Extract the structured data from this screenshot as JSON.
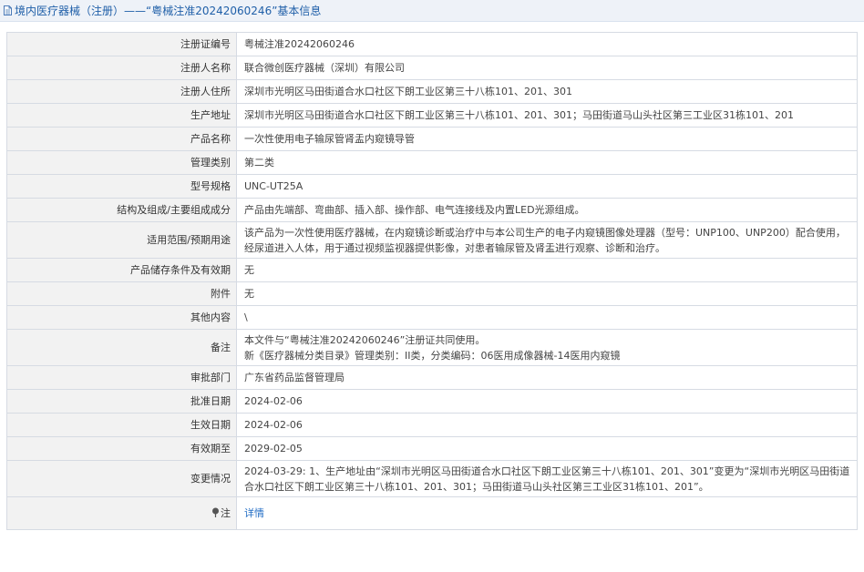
{
  "header": {
    "title": "境内医疗器械（注册）——“粤械注准20242060246”基本信息"
  },
  "rows": [
    {
      "label": "注册证编号",
      "value": "粤械注准20242060246"
    },
    {
      "label": "注册人名称",
      "value": "联合微创医疗器械（深圳）有限公司"
    },
    {
      "label": "注册人住所",
      "value": "深圳市光明区马田街道合水口社区下朗工业区第三十八栋101、201、301"
    },
    {
      "label": "生产地址",
      "value": "深圳市光明区马田街道合水口社区下朗工业区第三十八栋101、201、301；马田街道马山头社区第三工业区31栋101、201"
    },
    {
      "label": "产品名称",
      "value": "一次性使用电子输尿管肾盂内窥镜导管"
    },
    {
      "label": "管理类别",
      "value": "第二类"
    },
    {
      "label": "型号规格",
      "value": "UNC-UT25A"
    },
    {
      "label": "结构及组成/主要组成成分",
      "value": "产品由先端部、弯曲部、插入部、操作部、电气连接线及内置LED光源组成。"
    },
    {
      "label": "适用范围/预期用途",
      "value": "该产品为一次性使用医疗器械，在内窥镜诊断或治疗中与本公司生产的电子内窥镜图像处理器（型号：UNP100、UNP200）配合使用，经尿道进入人体，用于通过视频监视器提供影像，对患者输尿管及肾盂进行观察、诊断和治疗。"
    },
    {
      "label": "产品储存条件及有效期",
      "value": "无"
    },
    {
      "label": "附件",
      "value": "无"
    },
    {
      "label": "其他内容",
      "value": "\\"
    },
    {
      "label": "备注",
      "lines": [
        "本文件与“粤械注准20242060246”注册证共同使用。",
        "新《医疗器械分类目录》管理类别：II类，分类编码：06医用成像器械-14医用内窥镜"
      ]
    },
    {
      "label": "审批部门",
      "value": "广东省药品监督管理局"
    },
    {
      "label": "批准日期",
      "value": "2024-02-06"
    },
    {
      "label": "生效日期",
      "value": "2024-02-06"
    },
    {
      "label": "有效期至",
      "value": "2029-02-05"
    },
    {
      "label": "变更情况",
      "value": "2024-03-29: 1、生产地址由“深圳市光明区马田街道合水口社区下朗工业区第三十八栋101、201、301”变更为“深圳市光明区马田街道合水口社区下朗工业区第三十八栋101、201、301；马田街道马山头社区第三工业区31栋101、201”。"
    },
    {
      "label": "注",
      "link": "详情",
      "icon": "pin-icon"
    }
  ]
}
